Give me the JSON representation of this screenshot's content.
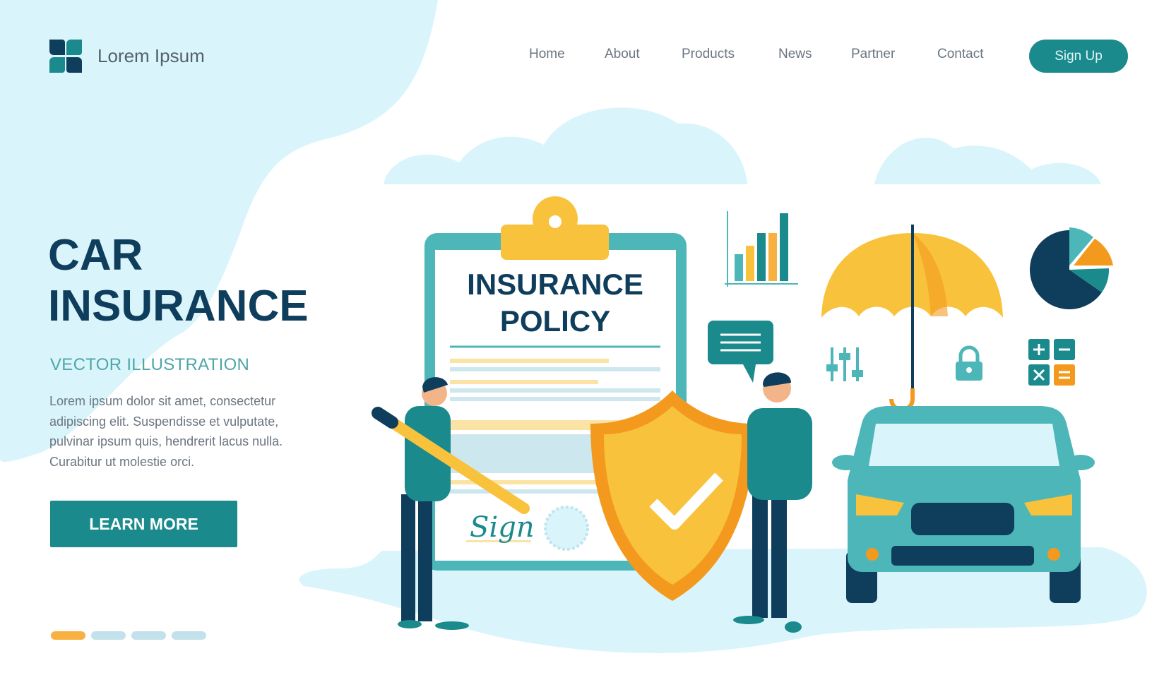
{
  "brand": {
    "name": "Lorem Ipsum",
    "logo_icon": "four-petal-logo-icon"
  },
  "nav": {
    "items": [
      {
        "label": "Home"
      },
      {
        "label": "About"
      },
      {
        "label": "Products"
      },
      {
        "label": "News"
      },
      {
        "label": "Partner"
      },
      {
        "label": "Contact"
      }
    ],
    "signup_label": "Sign Up"
  },
  "hero": {
    "title_line1": "CAR",
    "title_line2": "INSURANCE",
    "subtitle": "VECTOR ILLUSTRATION",
    "body": "Lorem ipsum dolor sit amet, consectetur adipiscing elit. Suspendisse et vulputate, pulvinar ipsum quis, hendrerit lacus nulla. Curabitur ut molestie orci.",
    "cta_label": "LEARN MORE"
  },
  "carousel": {
    "count": 4,
    "active_index": 0
  },
  "illustration": {
    "document_title_line1": "INSURANCE",
    "document_title_line2": "POLICY",
    "signature": "Sign",
    "icons": [
      "clipboard-icon",
      "bar-chart-icon",
      "umbrella-icon",
      "pie-chart-icon",
      "sliders-icon",
      "lock-icon",
      "calculator-icon",
      "speech-bubble-icon",
      "shield-check-icon",
      "car-icon"
    ]
  },
  "colors": {
    "navy": "#0f3d5c",
    "teal": "#1a8a8c",
    "light_teal": "#4db6b8",
    "yellow": "#f9c23c",
    "orange": "#f39a1e",
    "sky": "#d9f5fb"
  }
}
